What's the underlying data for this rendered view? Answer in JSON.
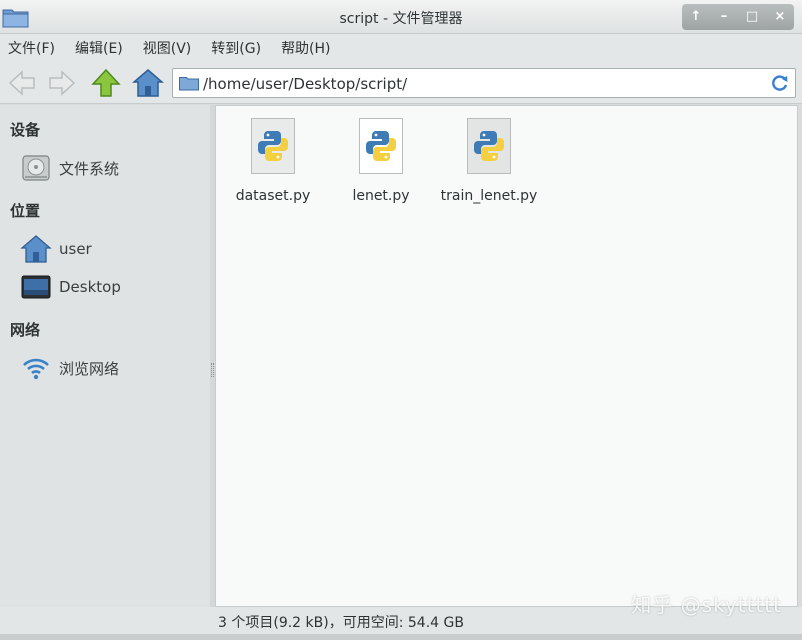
{
  "window": {
    "title": "script - 文件管理器"
  },
  "window_buttons": {
    "up": "↑",
    "minimize": "–",
    "maximize": "□",
    "close": "×"
  },
  "menu": {
    "items": [
      "文件(F)",
      "编辑(E)",
      "视图(V)",
      "转到(G)",
      "帮助(H)"
    ]
  },
  "toolbar": {
    "icons": [
      "back-icon",
      "forward-icon",
      "up-icon",
      "home-icon"
    ]
  },
  "location": {
    "path": "/home/user/Desktop/script/"
  },
  "sidebar": {
    "devices_heading": "设备",
    "devices": [
      {
        "label": "文件系统",
        "icon": "drive-icon"
      }
    ],
    "places_heading": "位置",
    "places": [
      {
        "label": "user",
        "icon": "home-folder-icon"
      },
      {
        "label": "Desktop",
        "icon": "desktop-icon"
      }
    ],
    "network_heading": "网络",
    "network": [
      {
        "label": "浏览网络",
        "icon": "network-icon"
      }
    ]
  },
  "files": [
    {
      "name": "dataset.py",
      "icon": "python-file-icon"
    },
    {
      "name": "lenet.py",
      "icon": "python-file-icon"
    },
    {
      "name": "train_lenet.py",
      "icon": "python-file-icon"
    }
  ],
  "status": {
    "text": "3 个项目(9.2 kB)，可用空间: 54.4 GB"
  },
  "watermark": {
    "text": "知乎 @skyttttt"
  },
  "colors": {
    "python_blue": "#3f7cb6",
    "python_yellow": "#f4cf3f",
    "folder_blue": "#5b8fc9",
    "up_arrow_green": "#8cc63f"
  }
}
